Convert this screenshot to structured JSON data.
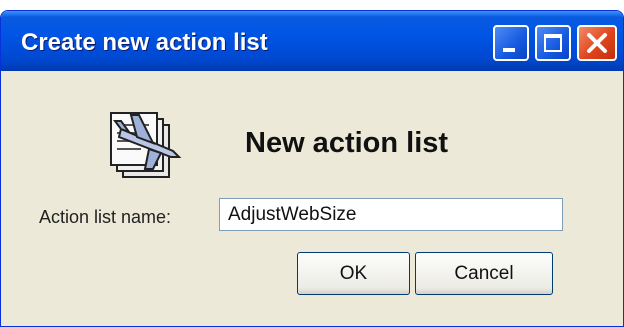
{
  "window": {
    "title": "Create new action list",
    "controls": {
      "minimize": "minimize-icon",
      "maximize": "maximize-icon",
      "close": "close-icon"
    }
  },
  "dialog": {
    "icon": "action-list-icon",
    "heading": "New action list",
    "name_label": "Action list name:",
    "name_value": "AdjustWebSize",
    "ok_label": "OK",
    "cancel_label": "Cancel"
  },
  "colors": {
    "titlebar": "#0055e5",
    "dialog_bg": "#ece9d8",
    "close_button": "#e0441c"
  }
}
